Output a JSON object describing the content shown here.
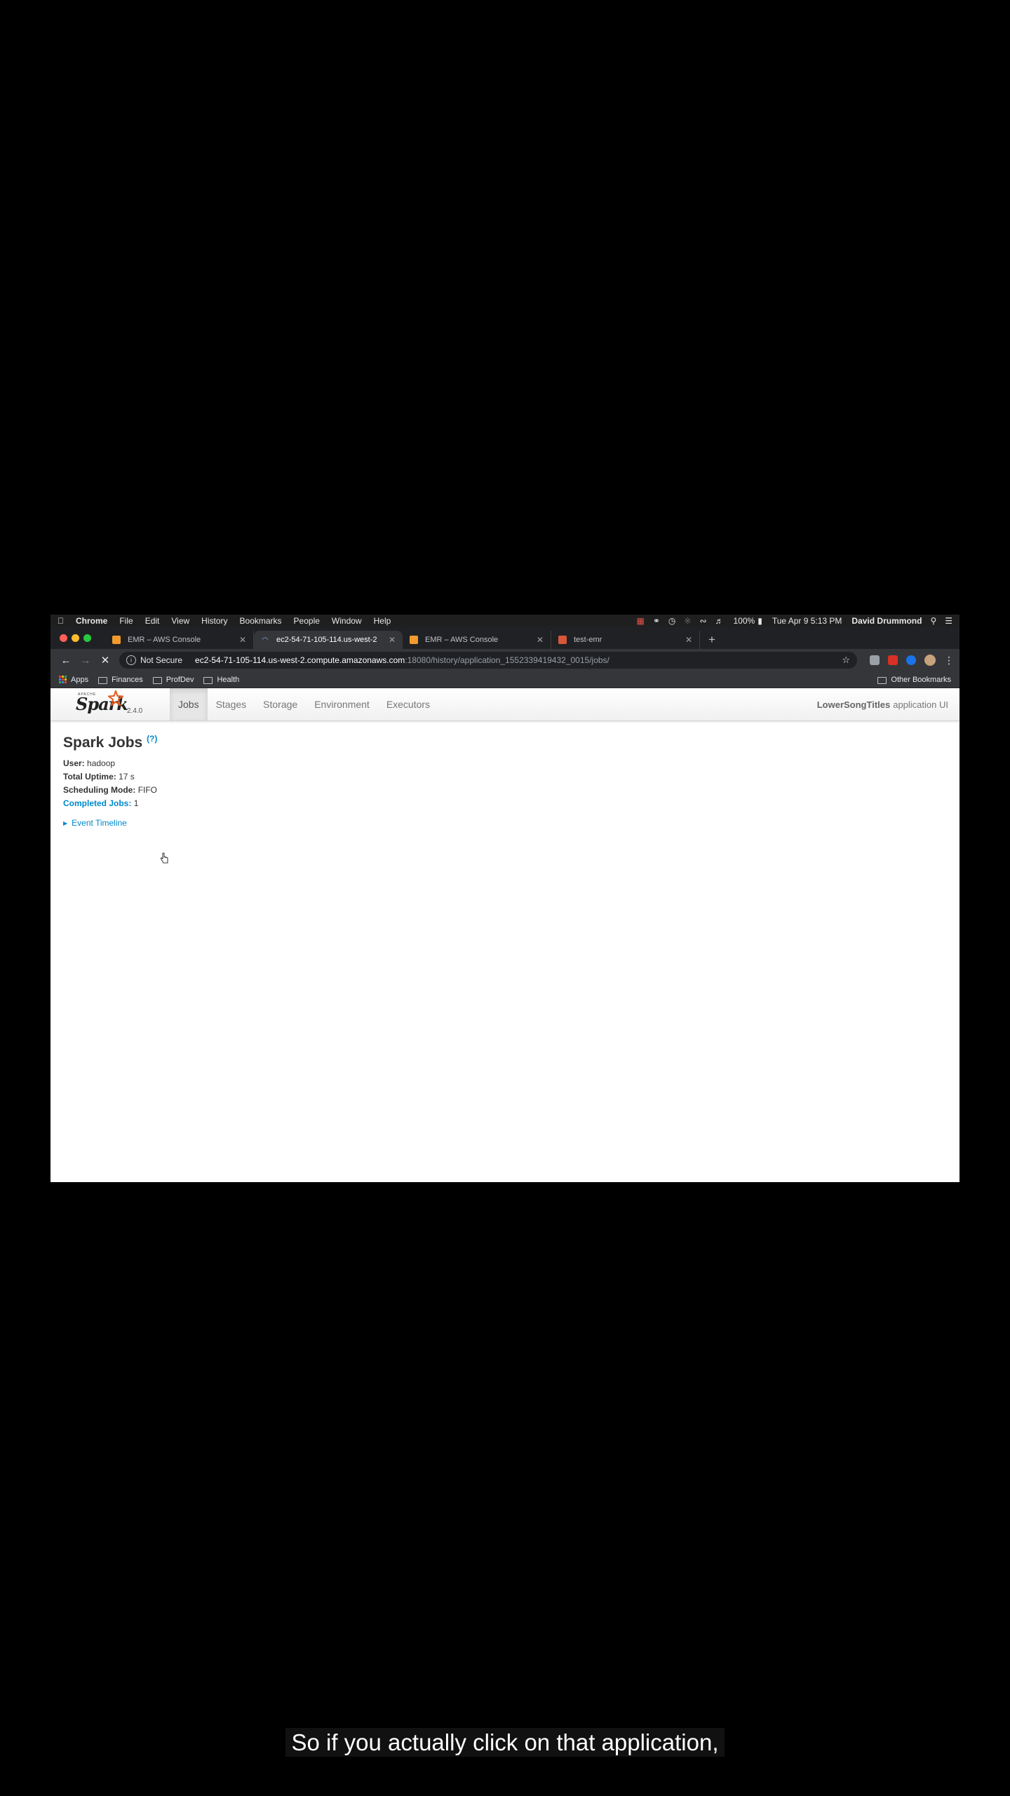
{
  "menubar": {
    "apple_icon": "apple-icon",
    "app_name": "Chrome",
    "items": [
      "File",
      "Edit",
      "View",
      "History",
      "Bookmarks",
      "People",
      "Window",
      "Help"
    ],
    "battery": "100%",
    "datetime": "Tue Apr 9  5:13 PM",
    "user": "David Drummond"
  },
  "tabs": [
    {
      "label": "EMR – AWS Console",
      "icon": "aws-icon"
    },
    {
      "label": "ec2-54-71-105-114.us-west-2",
      "icon": "loading-icon",
      "active": true
    },
    {
      "label": "EMR – AWS Console",
      "icon": "aws-icon"
    },
    {
      "label": "test-emr",
      "icon": "notebook-icon"
    }
  ],
  "address": {
    "security": "Not Secure",
    "host": "ec2-54-71-105-114.us-west-2.compute.amazonaws.com",
    "path": ":18080/history/application_1552339419432_0015/jobs/"
  },
  "bookmarks": {
    "items": [
      "Apps",
      "Finances",
      "ProfDev",
      "Health"
    ],
    "other": "Other Bookmarks"
  },
  "spark": {
    "brand": "Spark",
    "version": "2.4.0",
    "nav": [
      "Jobs",
      "Stages",
      "Storage",
      "Environment",
      "Executors"
    ],
    "active_nav": "Jobs",
    "app_name": "LowerSongTitles",
    "app_suffix": "application UI",
    "title": "Spark Jobs",
    "help": "(?)",
    "user_label": "User:",
    "user": "hadoop",
    "uptime_label": "Total Uptime:",
    "uptime": "17 s",
    "mode_label": "Scheduling Mode:",
    "mode": "FIFO",
    "completed_label": "Completed Jobs:",
    "completed": "1",
    "timeline": "Event Timeline"
  },
  "caption": "So if you actually click on that application,",
  "colors": {
    "spark_link": "#0088cc",
    "chrome_dark": "#35363a"
  }
}
